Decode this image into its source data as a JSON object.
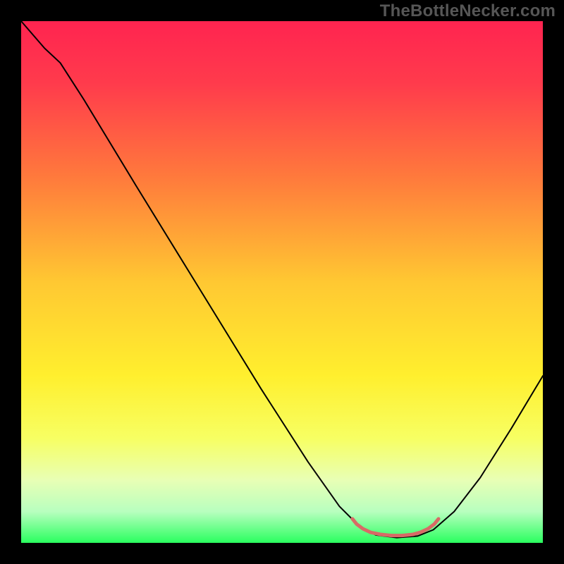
{
  "watermark": "TheBottleNecker.com",
  "chart_data": {
    "type": "line",
    "title": "",
    "xlabel": "",
    "ylabel": "",
    "xlim": [
      0,
      100
    ],
    "ylim": [
      0,
      100
    ],
    "background_gradient": {
      "stops": [
        {
          "offset": 0.0,
          "color": "#ff2450"
        },
        {
          "offset": 0.12,
          "color": "#ff3b4c"
        },
        {
          "offset": 0.3,
          "color": "#ff7a3c"
        },
        {
          "offset": 0.5,
          "color": "#ffc832"
        },
        {
          "offset": 0.68,
          "color": "#ffef2e"
        },
        {
          "offset": 0.8,
          "color": "#f7ff63"
        },
        {
          "offset": 0.88,
          "color": "#e8ffb5"
        },
        {
          "offset": 0.94,
          "color": "#b8ffbf"
        },
        {
          "offset": 1.0,
          "color": "#2aff5f"
        }
      ]
    },
    "series": [
      {
        "name": "bottleneck-curve",
        "color": "#000000",
        "width": 2.0,
        "points": [
          {
            "x": 0.0,
            "y": 100.0
          },
          {
            "x": 4.5,
            "y": 94.8
          },
          {
            "x": 7.5,
            "y": 92.0
          },
          {
            "x": 12.0,
            "y": 85.0
          },
          {
            "x": 22.0,
            "y": 68.5
          },
          {
            "x": 34.0,
            "y": 49.0
          },
          {
            "x": 46.0,
            "y": 29.5
          },
          {
            "x": 55.0,
            "y": 15.5
          },
          {
            "x": 61.0,
            "y": 7.0
          },
          {
            "x": 65.0,
            "y": 3.0
          },
          {
            "x": 68.0,
            "y": 1.5
          },
          {
            "x": 72.0,
            "y": 1.0
          },
          {
            "x": 76.0,
            "y": 1.3
          },
          {
            "x": 79.0,
            "y": 2.5
          },
          {
            "x": 83.0,
            "y": 6.0
          },
          {
            "x": 88.0,
            "y": 12.5
          },
          {
            "x": 94.0,
            "y": 22.0
          },
          {
            "x": 100.0,
            "y": 32.0
          }
        ]
      },
      {
        "name": "optimal-segment",
        "color": "#d86a66",
        "width": 5.0,
        "points": [
          {
            "x": 63.5,
            "y": 4.6
          },
          {
            "x": 64.3,
            "y": 3.6
          },
          {
            "x": 65.5,
            "y": 2.7
          },
          {
            "x": 67.0,
            "y": 2.0
          },
          {
            "x": 69.0,
            "y": 1.6
          },
          {
            "x": 71.0,
            "y": 1.4
          },
          {
            "x": 73.0,
            "y": 1.4
          },
          {
            "x": 75.0,
            "y": 1.6
          },
          {
            "x": 76.5,
            "y": 2.0
          },
          {
            "x": 78.0,
            "y": 2.7
          },
          {
            "x": 79.2,
            "y": 3.6
          },
          {
            "x": 80.0,
            "y": 4.6
          }
        ]
      }
    ]
  }
}
